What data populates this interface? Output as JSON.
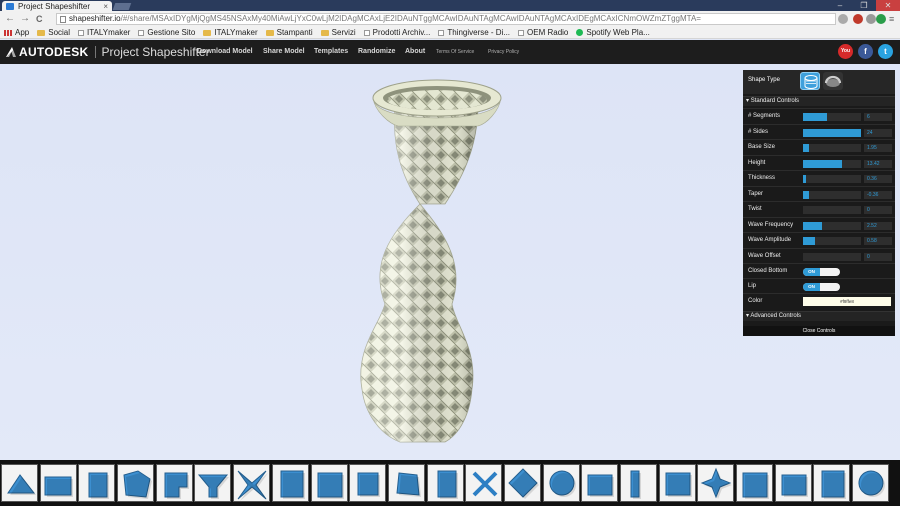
{
  "browser": {
    "tab_title": "Project Shapeshifter",
    "tab_close": "×",
    "window_controls": [
      "–",
      "❐",
      "✕"
    ],
    "url_host": "shapeshifter.io",
    "url_rest": "/#/share/MSAxIDYgMjQgMS45NSAxMy40MiAwLjYxC0wLjM2IDAgMCAxLjE2IDAuNTggMCAwIDAuNTAgMCAwIDAuNTAgMCAxIDEgMCAxICNmOWZmZTggMTA=",
    "nav": [
      "←",
      "→",
      "C"
    ],
    "bookmarks": [
      {
        "label": "App",
        "icon": "apps-grid-icon"
      },
      {
        "label": "Social",
        "icon": "folder-icon"
      },
      {
        "label": "ITALYmaker",
        "icon": "page-icon"
      },
      {
        "label": "Gestione Sito",
        "icon": "page-icon"
      },
      {
        "label": "ITALYmaker",
        "icon": "folder-icon"
      },
      {
        "label": "Stampanti",
        "icon": "folder-icon"
      },
      {
        "label": "Servizi",
        "icon": "folder-icon"
      },
      {
        "label": "Prodotti Archiv...",
        "icon": "page-icon"
      },
      {
        "label": "Thingiverse - Di...",
        "icon": "page-icon"
      },
      {
        "label": "OEM Radio",
        "icon": "page-icon"
      },
      {
        "label": "Spotify Web Pla...",
        "icon": "page-icon"
      }
    ]
  },
  "app": {
    "brand": "AUTODESK",
    "product": "Project Shapeshifter",
    "nav": [
      "Download Model",
      "Share Model",
      "Templates",
      "Randomize",
      "About"
    ],
    "nav_small": [
      "Terms Of Service",
      "Privacy Policy"
    ],
    "social": [
      {
        "name": "youtube-icon",
        "glyph": "You",
        "color": "#d62a2a"
      },
      {
        "name": "facebook-icon",
        "glyph": "f",
        "color": "#3b5998"
      },
      {
        "name": "twitter-icon",
        "glyph": "t",
        "color": "#2aa3e0"
      }
    ]
  },
  "panel": {
    "shape_type_label": "Shape Type",
    "standard_header": "Standard Controls",
    "advanced_header": "Advanced Controls",
    "close_label": "Close Controls",
    "sliders": [
      {
        "label": "# Segments",
        "value": "6",
        "fill": 0.42
      },
      {
        "label": "# Sides",
        "value": "24",
        "fill": 1.0
      },
      {
        "label": "Base Size",
        "value": "1.95",
        "fill": 0.1
      },
      {
        "label": "Height",
        "value": "13.42",
        "fill": 0.67
      },
      {
        "label": "Thickness",
        "value": "0.36",
        "fill": 0.06
      },
      {
        "label": "Taper",
        "value": "-0.36",
        "fill": 0.1
      },
      {
        "label": "Twist",
        "value": "0",
        "fill": 0.0
      },
      {
        "label": "Wave Frequency",
        "value": "2.52",
        "fill": 0.32
      },
      {
        "label": "Wave Amplitude",
        "value": "0.58",
        "fill": 0.2
      },
      {
        "label": "Wave Offset",
        "value": "0",
        "fill": 0.0
      }
    ],
    "toggles": [
      {
        "label": "Closed Bottom",
        "state": "ON"
      },
      {
        "label": "Lip",
        "state": "ON"
      }
    ],
    "color": {
      "label": "Color",
      "value": "#f9ffe8"
    }
  },
  "colors": {
    "accent": "#2f9bd6",
    "vase": "#eef0dc",
    "tray_shape": "#3c8fd0"
  },
  "tray": {
    "count": 23
  }
}
